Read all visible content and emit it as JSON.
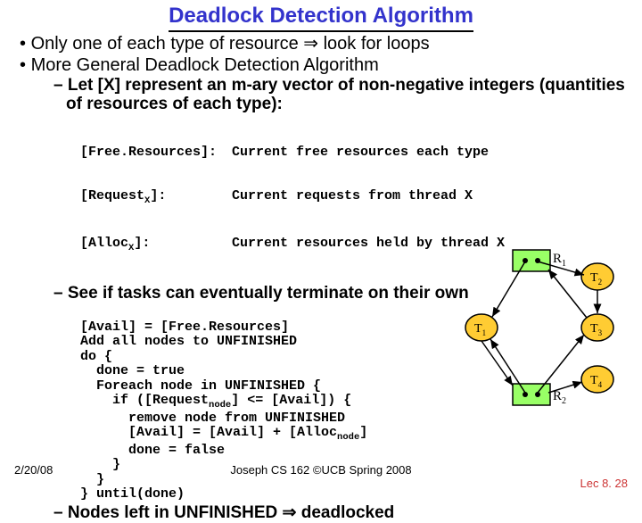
{
  "title": "Deadlock Detection Algorithm",
  "bullets": {
    "b1a": "Only one of each type of resource ⇒ look for loops",
    "b1b": "More General Deadlock Detection Algorithm",
    "b2a": "Let [X] represent an m-ary vector of non-negative integers (quantities of resources of each type):",
    "b2b": "See if tasks can eventually terminate on their own",
    "b2c": "Nodes left in UNFINISHED ⇒ deadlocked"
  },
  "defs": {
    "r1k": "[Free.Resources]:",
    "r1v": "Current free resources each type",
    "r2k": "[Request",
    "r2ks": "X",
    "r2ke": "]:",
    "r2v": "Current requests from thread X",
    "r3k": "[Alloc",
    "r3ks": "X",
    "r3ke": "]:",
    "r3v": "Current resources held by thread X"
  },
  "code": {
    "l1": "[Avail] = [Free.Resources]",
    "l2": "Add all nodes to UNFINISHED",
    "l3": "do {",
    "l4": "  done = true",
    "l5": "  Foreach node in UNFINISHED {",
    "l6a": "    if ([Request",
    "l6b": "node",
    "l6c": "] <= [Avail]) {",
    "l7": "      remove node from UNFINISHED",
    "l8a": "      [Avail] = [Avail] + [Alloc",
    "l8b": "node",
    "l8c": "]",
    "l9": "      done = false",
    "l10": "    }",
    "l11": "  }",
    "l12": "} until(done)"
  },
  "diagram": {
    "r1": "R",
    "r1s": "1",
    "r2": "R",
    "r2s": "2",
    "t1": "T",
    "t1s": "1",
    "t2": "T",
    "t2s": "2",
    "t3": "T",
    "t3s": "3",
    "t4": "T",
    "t4s": "4"
  },
  "footer": {
    "date": "2/20/08",
    "mid": "Joseph CS 162 ©UCB Spring 2008",
    "lec": "Lec 8. 28"
  }
}
